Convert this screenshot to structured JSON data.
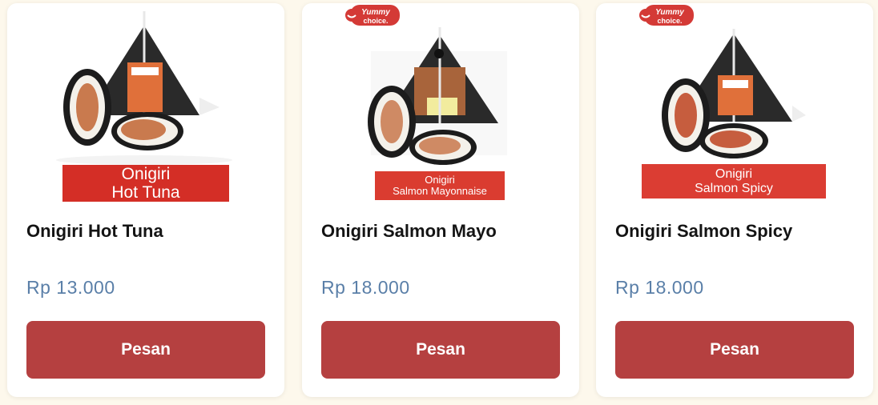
{
  "products": [
    {
      "name": "Onigiri Hot Tuna",
      "price": "Rp 13.000",
      "banner_line1": "Onigiri",
      "banner_line2": "Hot Tuna",
      "button": "Pesan"
    },
    {
      "name": "Onigiri Salmon Mayo",
      "price": "Rp 18.000",
      "banner_line1": "Onigiri",
      "banner_line2": "Salmon Mayonnaise",
      "button": "Pesan",
      "brand": "Yummy choice."
    },
    {
      "name": "Onigiri Salmon Spicy",
      "price": "Rp 18.000",
      "banner_line1": "Onigiri",
      "banner_line2": "Salmon Spicy",
      "button": "Pesan",
      "brand": "Yummy choice."
    }
  ],
  "colors": {
    "button": "#b54040",
    "price": "#5a7fa8",
    "banner": "#d42e26",
    "background": "#fdf8ec"
  },
  "icons": [
    "onigiri-product-image",
    "yummy-choice-logo"
  ]
}
